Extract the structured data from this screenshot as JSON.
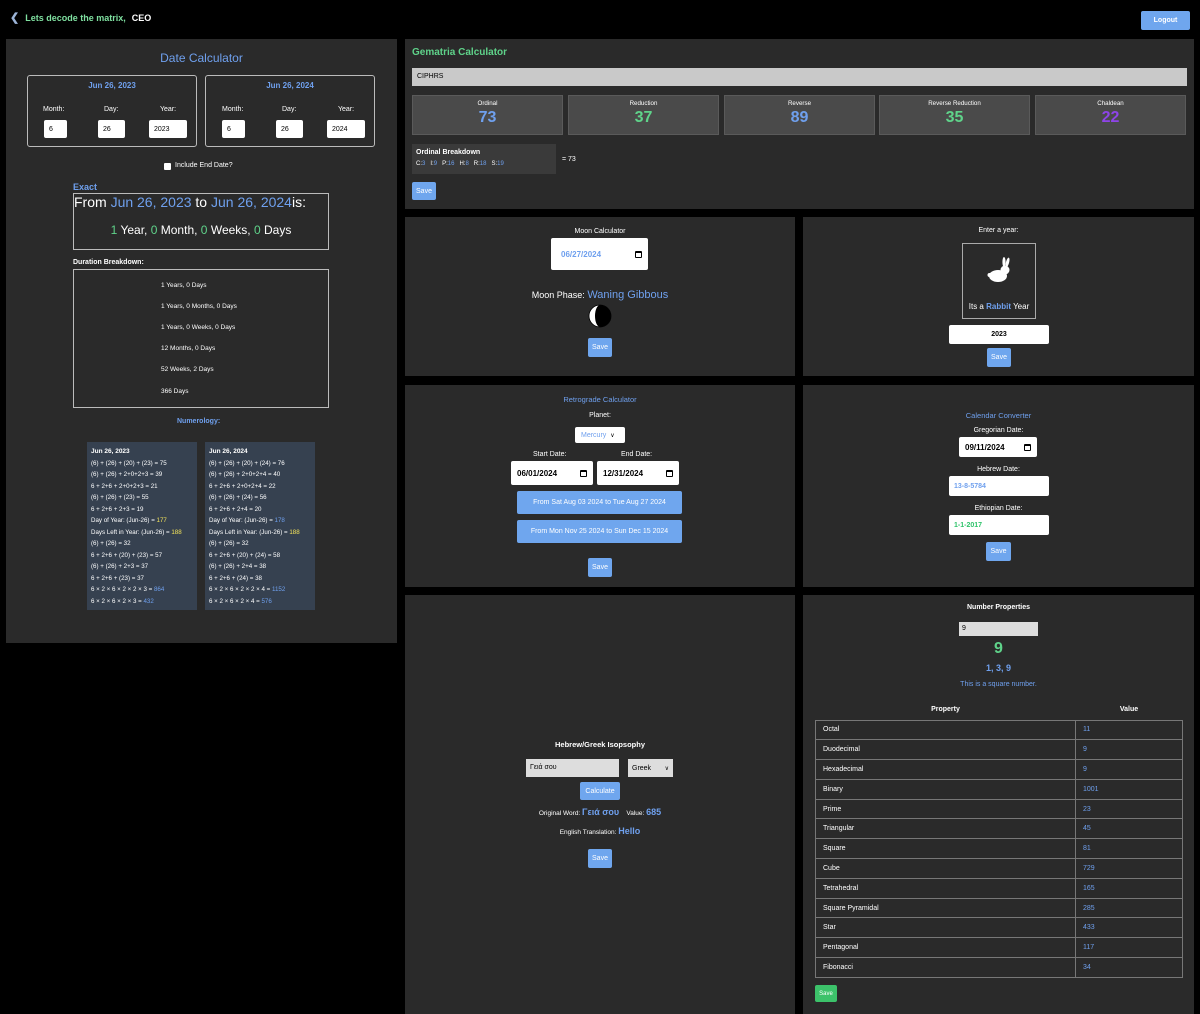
{
  "header": {
    "back_text": "Lets decode the matrix,",
    "user": "CEO",
    "logout": "Logout"
  },
  "date_calc": {
    "title": "Date Calculator",
    "start": {
      "heading": "Jun 26, 2023",
      "month_label": "Month:",
      "day_label": "Day:",
      "year_label": "Year:",
      "month": "6",
      "day": "26",
      "year": "2023"
    },
    "end": {
      "heading": "Jun 26, 2024",
      "month_label": "Month:",
      "day_label": "Day:",
      "year_label": "Year:",
      "month": "6",
      "day": "26",
      "year": "2024"
    },
    "include_end": "Include End Date?",
    "exact_label": "Exact",
    "from_word": "From",
    "from_date": "Jun 26, 2023",
    "to_word": "to",
    "to_date": "Jun 26, 2024",
    "is_word": "is:",
    "years": "1",
    "years_word": "Year,",
    "months": "0",
    "months_word": "Month,",
    "weeks": "0",
    "weeks_word": "Weeks,",
    "days": "0",
    "days_word": "Days",
    "breakdown_label": "Duration Breakdown:",
    "breakdown": [
      "1 Years, 0 Days",
      "1 Years, 0 Months, 0 Days",
      "1 Years, 0 Weeks, 0 Days",
      "12 Months, 0 Days",
      "52 Weeks, 2 Days",
      "366 Days"
    ],
    "numerology_label": "Numerology:",
    "num_left": {
      "heading": "Jun 26, 2023",
      "lines": [
        "(6) + (26) + (20) + (23) = 75",
        "(6) + (26) + 2+0+2+3 = 39",
        "6 + 2+6 + 2+0+2+3 = 21",
        "(6) + (26) + (23) = 55",
        "6 + 2+6 + 2+3 = 19"
      ],
      "doy_label": "Day of Year: (Jun-26) = ",
      "doy": "177",
      "dl_label": "Days Left in Year: (Jun-26) = ",
      "dl": "188",
      "lines2": [
        "(6) + (26) = 32",
        "6 + 2+6 + (20) + (23) = 57",
        "(6) + (26) + 2+3 = 37",
        "6 + 2+6 + (23) = 37"
      ],
      "prod1_label": "6 × 2 × 6 × 2 × 2 × 3 = ",
      "prod1": "864",
      "prod2_label": "6 × 2 × 6 × 2 × 3 = ",
      "prod2": "432"
    },
    "num_right": {
      "heading": "Jun 26, 2024",
      "lines": [
        "(6) + (26) + (20) + (24) = 76",
        "(6) + (26) + 2+0+2+4 = 40",
        "6 + 2+6 + 2+0+2+4 = 22",
        "(6) + (26) + (24) = 56",
        "6 + 2+6 + 2+4 = 20"
      ],
      "doy_label": "Day of Year: (Jun-26) = ",
      "doy": "178",
      "dl_label": "Days Left in Year: (Jun-26) = ",
      "dl": "188",
      "lines2": [
        "(6) + (26) = 32",
        "6 + 2+6 + (20) + (24) = 58",
        "(6) + (26) + 2+4 = 38",
        "6 + 2+6 + (24) = 38"
      ],
      "prod1_label": "6 × 2 × 6 × 2 × 2 × 4 = ",
      "prod1": "1152",
      "prod2_label": "6 × 2 × 6 × 2 × 4 = ",
      "prod2": "576"
    }
  },
  "gematria": {
    "title": "Gematria Calculator",
    "input": "CIPHRS",
    "tiles": [
      {
        "label": "Ordinal",
        "value": "73",
        "color": "#6fa0ee"
      },
      {
        "label": "Reduction",
        "value": "37",
        "color": "#5fd38a"
      },
      {
        "label": "Reverse",
        "value": "89",
        "color": "#6fa0ee"
      },
      {
        "label": "Reverse Reduction",
        "value": "35",
        "color": "#5fd38a"
      },
      {
        "label": "Chaldean",
        "value": "22",
        "color": "#8e44e8"
      }
    ],
    "breakdown_title": "Ordinal Breakdown",
    "letters": [
      {
        "l": "C:",
        "v": "3"
      },
      {
        "l": "I:",
        "v": "9"
      },
      {
        "l": "P:",
        "v": "16"
      },
      {
        "l": "H:",
        "v": "8"
      },
      {
        "l": "R:",
        "v": "18"
      },
      {
        "l": "S:",
        "v": "19"
      }
    ],
    "total": "= 73",
    "save": "Save"
  },
  "moon": {
    "title": "Moon Calculator",
    "date": "06/27/2024",
    "phase_label": "Moon Phase:",
    "phase": "Waning Gibbous",
    "save": "Save"
  },
  "zodiac": {
    "title": "Enter a year:",
    "its_a": "Its a",
    "animal": "Rabbit",
    "year_word": "Year",
    "year": "2023",
    "save": "Save"
  },
  "retro": {
    "title": "Retrograde Calculator",
    "planet_label": "Planet:",
    "planet": "Mercury",
    "start_label": "Start Date:",
    "end_label": "End Date:",
    "start": "06/01/2024",
    "end": "12/31/2024",
    "periods": [
      "From Sat Aug 03 2024 to Tue Aug 27 2024",
      "From Mon Nov 25 2024 to Sun Dec 15 2024"
    ],
    "save": "Save"
  },
  "calconv": {
    "title": "Calendar Converter",
    "greg_label": "Gregorian Date:",
    "greg": "09/11/2024",
    "heb_label": "Hebrew Date:",
    "heb": "13-8-5784",
    "eth_label": "Ethiopian Date:",
    "eth": "1-1-2017",
    "save": "Save"
  },
  "isopsophy": {
    "title": "Hebrew/Greek Isopsophy",
    "word": "Γειά σου",
    "lang": "Greek",
    "calculate": "Calculate",
    "orig_label": "Original Word:",
    "orig": "Γειά σου",
    "value_label": "Value:",
    "value": "685",
    "trans_label": "English Translation:",
    "trans": "Hello",
    "save": "Save"
  },
  "numprops": {
    "title": "Number Properties",
    "input": "9",
    "number": "9",
    "factors": "1, 3, 9",
    "note": "This is a square number.",
    "col_property": "Property",
    "col_value": "Value",
    "rows": [
      {
        "p": "Octal",
        "v": "11"
      },
      {
        "p": "Duodecimal",
        "v": "9"
      },
      {
        "p": "Hexadecimal",
        "v": "9"
      },
      {
        "p": "Binary",
        "v": "1001"
      },
      {
        "p": "Prime",
        "v": "23"
      },
      {
        "p": "Triangular",
        "v": "45"
      },
      {
        "p": "Square",
        "v": "81"
      },
      {
        "p": "Cube",
        "v": "729"
      },
      {
        "p": "Tetrahedral",
        "v": "165"
      },
      {
        "p": "Square Pyramidal",
        "v": "285"
      },
      {
        "p": "Star",
        "v": "433"
      },
      {
        "p": "Pentagonal",
        "v": "117"
      },
      {
        "p": "Fibonacci",
        "v": "34"
      }
    ],
    "save": "Save"
  }
}
